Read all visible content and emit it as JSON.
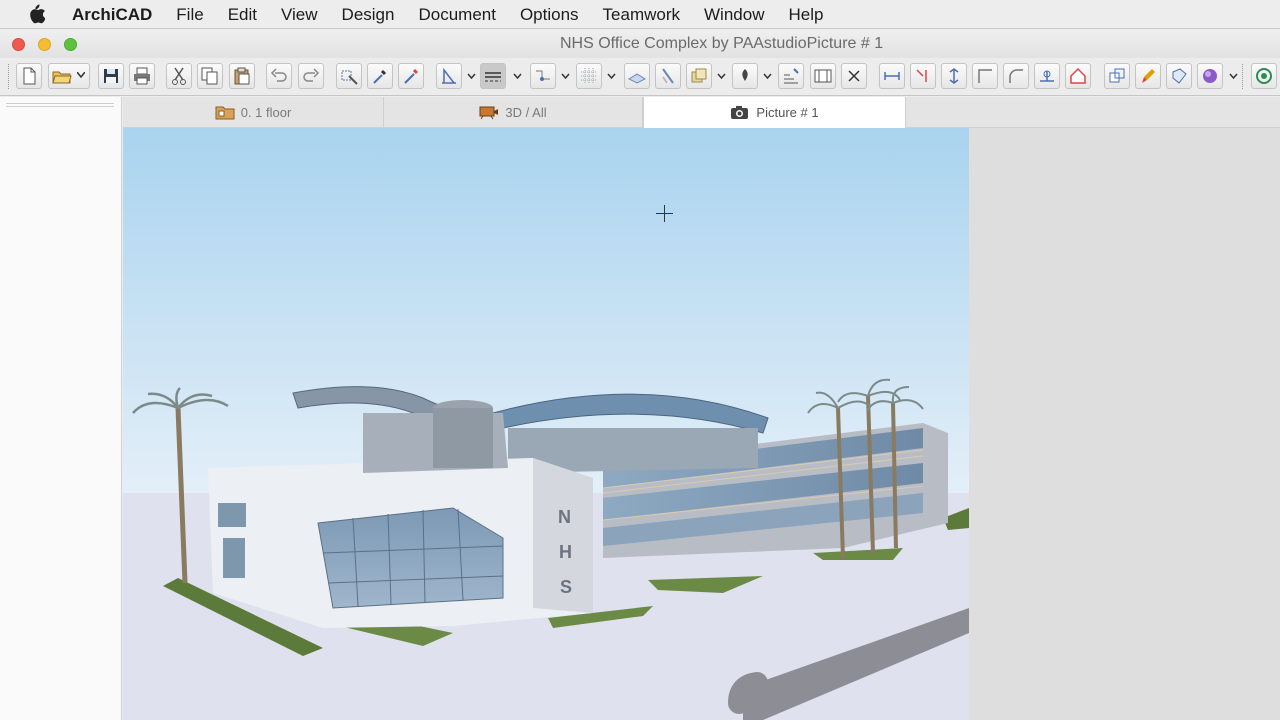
{
  "menu": {
    "apple_icon": "apple-icon",
    "app": "ArchiCAD",
    "items": [
      "File",
      "Edit",
      "View",
      "Design",
      "Document",
      "Options",
      "Teamwork",
      "Window",
      "Help"
    ]
  },
  "window": {
    "title": "NHS Office Complex by PAAstudioPicture # 1",
    "buttons": {
      "close": "#ee5a52",
      "minimize": "#f5be32",
      "zoom": "#5fc23f"
    }
  },
  "toolbar": {
    "tools": [
      "new-file-icon",
      "open-folder-icon",
      "save-icon",
      "print-icon",
      "cut-icon",
      "copy-icon",
      "paste-icon",
      "undo-icon",
      "redo-icon",
      "magic-wand-icon",
      "eyedropper-icon",
      "inject-icon",
      "gravity-icon",
      "line-type-icon",
      "trace-icon",
      "grid-icon",
      "plane-icon",
      "snap-icon",
      "layers-icon",
      "pen-icon",
      "elevation-icon",
      "section-icon",
      "close-x-icon",
      "align-icon",
      "offset-icon",
      "stretch-icon",
      "corner-icon",
      "fillet-icon",
      "split-icon",
      "roof-icon",
      "group-icon",
      "brush-icon",
      "render-icon",
      "sphere-icon",
      "bimx-icon"
    ]
  },
  "tabs": [
    {
      "icon": "floor-plan-folder-icon",
      "label": "0. 1 floor"
    },
    {
      "icon": "3d-view-icon",
      "label": "3D / All"
    },
    {
      "icon": "camera-icon",
      "label": "Picture # 1"
    }
  ],
  "viewport": {
    "image": "rendered-building-image",
    "signage": "NHS",
    "colors": {
      "sky_top": "#a9d3ef",
      "sky_bottom": "#eef3f8",
      "ground": "#dfe1ee"
    }
  }
}
